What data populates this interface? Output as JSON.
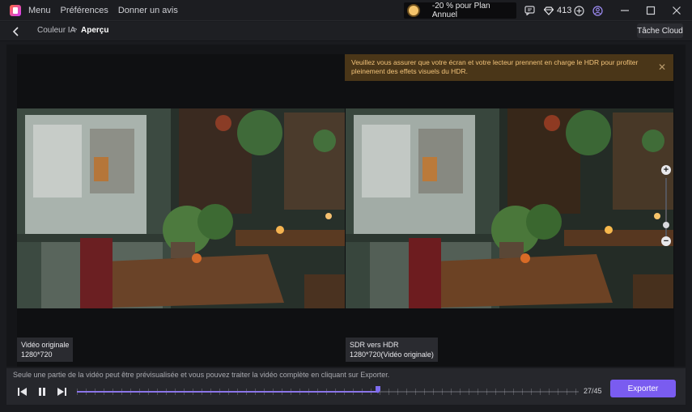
{
  "titlebar": {
    "menu_items": [
      "Menu",
      "Préférences",
      "Donner un avis"
    ],
    "promo_text": "-20 % pour Plan Annuel",
    "credits": "413"
  },
  "breadcrumb": {
    "parent": "Couleur IA",
    "separator": ">",
    "current": "Aperçu",
    "cloud_task": "Tâche Cloud"
  },
  "notice": {
    "text": "Veuillez vous assurer que votre écran et votre lecteur prennent en charge le HDR pour profiter pleinement des effets visuels du HDR.",
    "close": "✕"
  },
  "videos": {
    "left": {
      "title": "Vidéo originale",
      "resolution": "1280*720"
    },
    "right": {
      "title": "SDR vers HDR",
      "resolution": "1280*720(Vidéo originale)"
    }
  },
  "zoom": {
    "plus": "+",
    "minus": "−"
  },
  "player": {
    "info": "Seule une partie de la vidéo peut être prévisualisée et vous pouvez traiter la vidéo complète en cliquant sur Exporter.",
    "current_frame": 27,
    "total_frames": 45,
    "counter": "27/45",
    "export_label": "Exporter"
  },
  "colors": {
    "accent": "#7a5cf0",
    "notice_bg": "#4a3618",
    "notice_text": "#f2c37a"
  },
  "icons": [
    "app-logo-icon",
    "promo-sun-icon",
    "message-icon",
    "diamond-icon",
    "add-credits-icon",
    "user-icon",
    "minimize-icon",
    "maximize-icon",
    "close-icon",
    "back-arrow-icon",
    "skip-back-icon",
    "pause-icon",
    "skip-forward-icon"
  ]
}
